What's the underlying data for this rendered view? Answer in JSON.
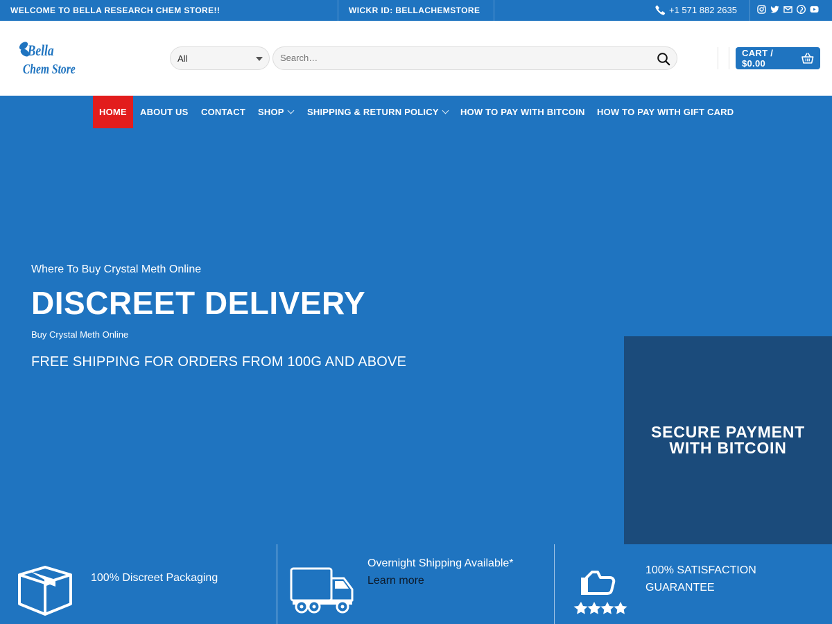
{
  "topbar": {
    "welcome": "WELCOME TO BELLA RESEARCH CHEM STORE!!",
    "wickr": "WICKR ID: BELLACHEMSTORE",
    "phone": "+1 571 882 2635",
    "social_icons": [
      "instagram-icon",
      "twitter-icon",
      "envelope-icon",
      "pinterest-icon",
      "youtube-icon"
    ]
  },
  "header": {
    "logo_text": "Bella Chem Store",
    "category_select": "All",
    "search_placeholder": "Search…",
    "cart_label": "CART / $0.00"
  },
  "nav": {
    "items": [
      {
        "label": "HOME",
        "active": true
      },
      {
        "label": "ABOUT US"
      },
      {
        "label": "CONTACT"
      },
      {
        "label": "SHOP",
        "dropdown": true
      },
      {
        "label": "SHIPPING & RETURN POLICY",
        "dropdown": true
      },
      {
        "label": "HOW TO PAY WITH BITCOIN"
      },
      {
        "label": "HOW TO PAY WITH GIFT CARD"
      }
    ]
  },
  "hero": {
    "subtitle": "Where To Buy Crystal Meth Online",
    "title": "DISCREET DELIVERY",
    "small": "Buy Crystal Meth Online",
    "free_shipping": "FREE SHIPPING FOR ORDERS FROM 100G AND ABOVE"
  },
  "secure_box": {
    "line1": "SECURE PAYMENT",
    "line2": "WITH BITCOIN"
  },
  "features": [
    {
      "icon": "box-icon",
      "text": "100% Discreet Packaging"
    },
    {
      "icon": "truck-icon",
      "text": "Overnight Shipping Available*",
      "link": "Learn more"
    },
    {
      "icon": "rating-icon",
      "line1": "100% SATISFACTION",
      "line2": "GUARANTEE"
    }
  ],
  "colors": {
    "primary_blue": "#1f74c0",
    "dark_blue": "#1b4b7b",
    "active_red": "#e21d1d"
  }
}
